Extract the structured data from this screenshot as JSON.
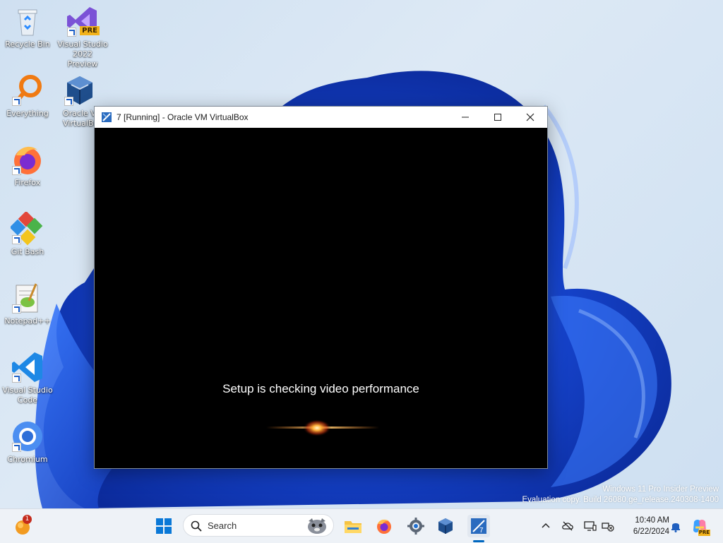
{
  "desktop": {
    "icons": [
      {
        "label": "Recycle Bin"
      },
      {
        "label": "Visual Studio 2022 Preview",
        "badge": "PRE"
      },
      {
        "label": "Everything"
      },
      {
        "label": "Oracle VM VirtualBox",
        "visible_label": "Oracle V\nVirtualBo"
      },
      {
        "label": "Firefox"
      },
      {
        "label": "Git Bash"
      },
      {
        "label": "Notepad++"
      },
      {
        "label": "Visual Studio Code"
      },
      {
        "label": "Chromium"
      }
    ],
    "watermark": {
      "line1": "Windows 11 Pro Insider Preview",
      "line2": "Evaluation copy. Build 26080.ge_release.240308-1400"
    }
  },
  "window": {
    "title": "7 [Running] - Oracle VM VirtualBox",
    "controls": {
      "minimize": "minimize-icon",
      "maximize": "maximize-icon",
      "close": "close-icon"
    },
    "vm_screen": {
      "message": "Setup is checking video performance"
    }
  },
  "taskbar": {
    "search_placeholder": "Search",
    "notification_count": "1",
    "pinned": [
      "start-icon",
      "file-explorer-icon",
      "firefox-icon",
      "settings-icon",
      "virtualbox-icon",
      "vm-7-icon"
    ],
    "tray": [
      "chevron-up-icon",
      "onedrive-offline-icon",
      "display-icon",
      "network-icon"
    ],
    "clock": {
      "time": "10:40 AM",
      "date": "6/22/2024"
    },
    "copilot_badge": "PRE"
  },
  "colors": {
    "accent": "#0067c0",
    "bloom": "#1a4fd6",
    "taskbar": "#eef2f7"
  }
}
